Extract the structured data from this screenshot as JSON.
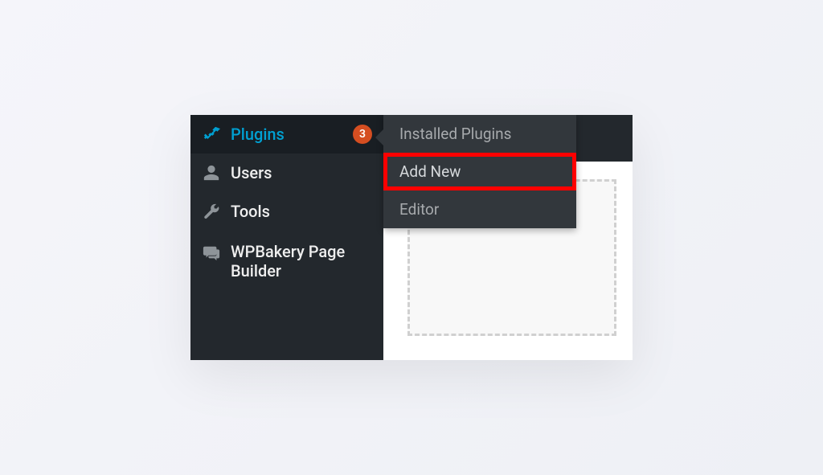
{
  "sidebar": {
    "items": [
      {
        "label": "Plugins",
        "badge": "3",
        "icon": "plug"
      },
      {
        "label": "Users",
        "icon": "user"
      },
      {
        "label": "Tools",
        "icon": "wrench"
      },
      {
        "label": "WPBakery Page Builder",
        "icon": "comments"
      }
    ]
  },
  "submenu": {
    "items": [
      {
        "label": "Installed Plugins"
      },
      {
        "label": "Add New"
      },
      {
        "label": "Editor"
      }
    ]
  }
}
